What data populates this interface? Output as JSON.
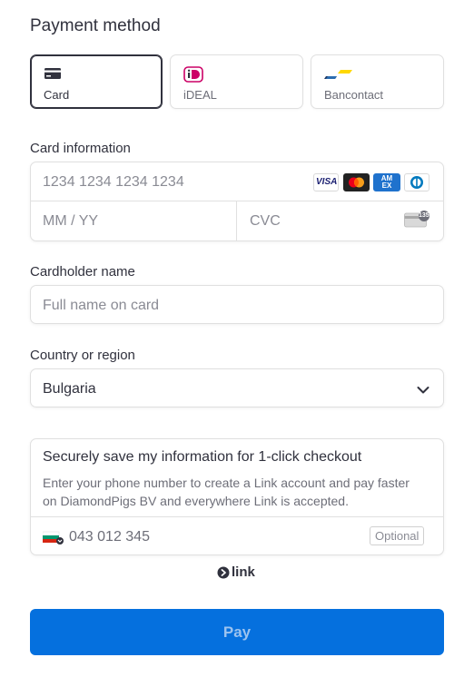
{
  "payment_method": {
    "title": "Payment method",
    "tabs": [
      {
        "label": "Card",
        "icon": "card-icon",
        "selected": true
      },
      {
        "label": "iDEAL",
        "icon": "ideal-icon",
        "selected": false
      },
      {
        "label": "Bancontact",
        "icon": "bancontact-icon",
        "selected": false
      }
    ]
  },
  "card_information": {
    "label": "Card information",
    "number_placeholder": "1234 1234 1234 1234",
    "brands": [
      "visa-icon",
      "mastercard-icon",
      "amex-icon",
      "diners-icon"
    ],
    "brand_visa_text": "VISA",
    "brand_amex_text": "AM EX",
    "expiry_placeholder": "MM / YY",
    "cvc_placeholder": "CVC",
    "cvc_icon_text": "135"
  },
  "cardholder": {
    "label": "Cardholder name",
    "placeholder": "Full name on card"
  },
  "country": {
    "label": "Country or region",
    "value": "Bulgaria"
  },
  "link_save": {
    "heading": "Securely save my information for 1-click checkout",
    "description": "Enter your phone number to create a Link account and pay faster on DiamondPigs BV and everywhere Link is accepted.",
    "phone_value": "043 012 345",
    "optional_badge": "Optional",
    "link_logo_text": "link"
  },
  "pay_button": {
    "label": "Pay"
  },
  "colors": {
    "accent": "#0570de",
    "text": "#30313d",
    "placeholder": "#8a8b94",
    "border": "#e0e0e0"
  }
}
